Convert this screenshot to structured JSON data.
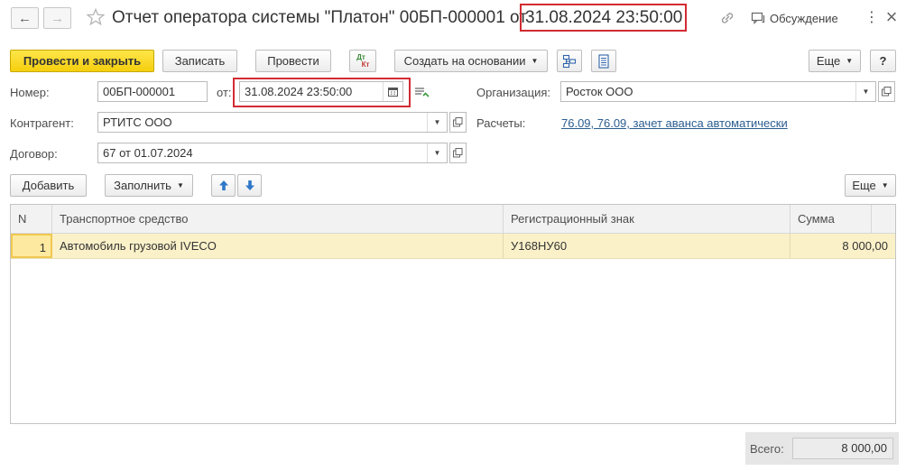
{
  "window": {
    "title": "Отчет оператора системы \"Платон\" 00БП-000001 от",
    "title_date": "31.08.2024 23:50:00",
    "discussion_label": "Обсуждение",
    "more_menu": "⋮",
    "close": "×"
  },
  "toolbar": {
    "post_and_close": "Провести и закрыть",
    "save": "Записать",
    "post": "Провести",
    "dt_kt_top": "Дт",
    "dt_kt_bottom": "Кт",
    "create_based_on": "Создать на основании",
    "more": "Еще",
    "help": "?"
  },
  "form": {
    "number_label": "Номер:",
    "number_value": "00БП-000001",
    "date_label": "от:",
    "date_value": "31.08.2024 23:50:00",
    "organization_label": "Организация:",
    "organization_value": "Росток ООО",
    "counterparty_label": "Контрагент:",
    "counterparty_value": "РТИТС ООО",
    "settlements_label": "Расчеты:",
    "settlements_link": "76.09, 76.09, зачет аванса автоматически",
    "contract_label": "Договор:",
    "contract_value": "67 от 01.07.2024"
  },
  "table_toolbar": {
    "add": "Добавить",
    "fill": "Заполнить",
    "more": "Еще"
  },
  "table": {
    "columns": [
      "N",
      "Транспортное средство",
      "Регистрационный знак",
      "Сумма"
    ],
    "rows": [
      {
        "n": "1",
        "vehicle": "Автомобиль грузовой IVECO",
        "plate": "У168НУ60",
        "sum": "8 000,00"
      }
    ]
  },
  "footer": {
    "total_label": "Всего:",
    "total_value": "8 000,00"
  },
  "colors": {
    "accent_yellow": "#f5cf0d",
    "highlight_red": "#d22b33",
    "link_blue": "#2b5d8f",
    "selected_row": "#fbf1c9"
  }
}
